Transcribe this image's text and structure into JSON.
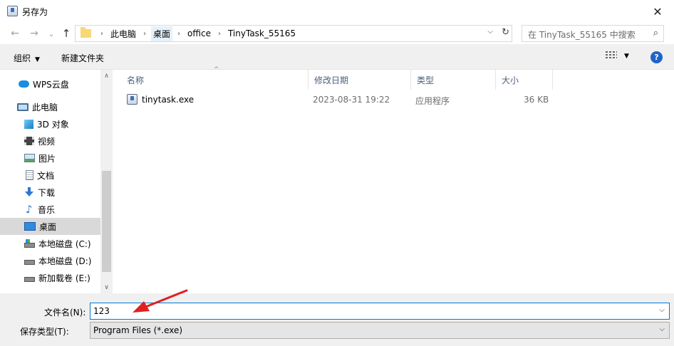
{
  "window": {
    "title": "另存为",
    "close_glyph": "✕"
  },
  "nav": {
    "back_glyph": "←",
    "forward_glyph": "→",
    "recent_glyph": "⌄",
    "up_glyph": "↑",
    "breadcrumbs": [
      "此电脑",
      "桌面",
      "office",
      "TinyTask_55165"
    ],
    "crumb_sep": "›",
    "dropdown_glyph": "⌵",
    "refresh_glyph": "↻",
    "search_placeholder": "在 TinyTask_55165 中搜索",
    "search_glyph": "⌕"
  },
  "toolbar": {
    "organize_label": "组织",
    "organize_caret": "▼",
    "new_folder_label": "新建文件夹",
    "view_caret": "▼",
    "help_glyph": "?"
  },
  "tree": {
    "items": [
      {
        "label": "WPS云盘",
        "icon": "cloud-icon"
      },
      {
        "label": "此电脑",
        "icon": "pc-icon"
      },
      {
        "label": "3D 对象",
        "icon": "cube-icon"
      },
      {
        "label": "视频",
        "icon": "video-icon"
      },
      {
        "label": "图片",
        "icon": "picture-icon"
      },
      {
        "label": "文档",
        "icon": "document-icon"
      },
      {
        "label": "下载",
        "icon": "download-icon"
      },
      {
        "label": "音乐",
        "icon": "music-icon"
      },
      {
        "label": "桌面",
        "icon": "desktop-icon",
        "selected": true
      },
      {
        "label": "本地磁盘 (C:)",
        "icon": "drive-icon"
      },
      {
        "label": "本地磁盘 (D:)",
        "icon": "drive-icon"
      },
      {
        "label": "新加载卷 (E:)",
        "icon": "drive-icon"
      }
    ],
    "scroll_up": "∧",
    "scroll_down": "∨"
  },
  "filelist": {
    "sort_caret": "^",
    "columns": {
      "name": "名称",
      "modified": "修改日期",
      "type": "类型",
      "size": "大小"
    },
    "rows": [
      {
        "name": "tinytask.exe",
        "modified": "2023-08-31 19:22",
        "type": "应用程序",
        "size": "36 KB"
      }
    ]
  },
  "bottom": {
    "filename_label": "文件名(N):",
    "filename_value": "123",
    "filetype_label": "保存类型(T):",
    "filetype_value": "Program Files (*.exe)",
    "dropdown_glyph": "⌵"
  },
  "colors": {
    "accent": "#0078d7",
    "annotation_arrow": "#e02020",
    "selection": "#d9d9d9"
  }
}
